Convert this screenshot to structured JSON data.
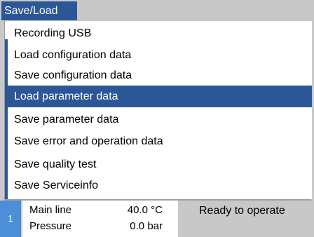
{
  "title": "Save/Load",
  "menu": {
    "items": [
      {
        "label": "Recording USB"
      },
      {
        "label": "Load configuration data"
      },
      {
        "label": "Save configuration data"
      },
      {
        "label": "Load parameter data"
      },
      {
        "label": "Save parameter data"
      },
      {
        "label": "Save error and operation data"
      },
      {
        "label": "Save quality test"
      },
      {
        "label": "Save Serviceinfo"
      }
    ],
    "selected_index": 3
  },
  "status": {
    "number": "1",
    "rows": [
      {
        "label": "Main line",
        "value": "40.0 °C"
      },
      {
        "label": "Pressure",
        "value": "0.0 bar"
      }
    ],
    "message": "Ready to operate"
  },
  "colors": {
    "accent": "#2b5797",
    "status_number_bg": "#4a8fd8",
    "background": "#c8c8c8"
  }
}
